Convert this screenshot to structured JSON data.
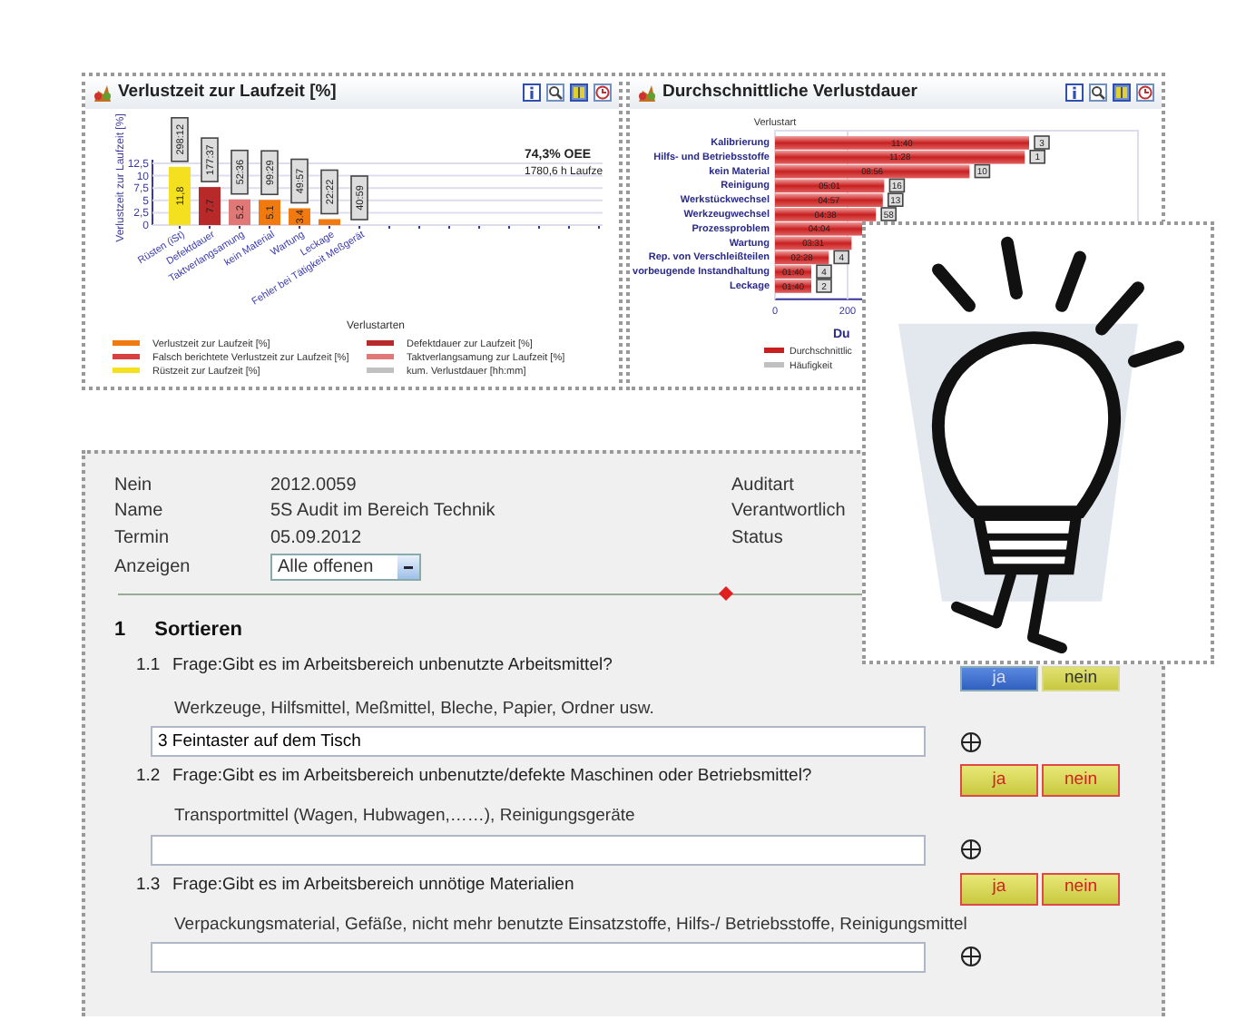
{
  "charts": [
    {
      "title": "Verlustzeit zur Laufzeit [%]",
      "summary": [
        "74,3% OEE",
        "1780,6 h Laufze"
      ],
      "chart_data": {
        "type": "bar",
        "xlabel": "Verlustarten",
        "ylabel": "Verlustzeit zur Laufzeit [%]",
        "categories": [
          "Rüsten (iSt)",
          "Defektdauer",
          "Taktverlangsamung",
          "kein Material",
          "Wartung",
          "Leckage",
          "Fehler bei Tätigkeit Meßgerät"
        ],
        "grid": true,
        "legend": true,
        "ylim": [
          0,
          12.5
        ],
        "yticks": [
          0,
          {
            "value": 2.5,
            "label": "2,5"
          },
          5,
          {
            "value": 7.5,
            "label": "7,5"
          },
          10,
          {
            "value": 12.5,
            "label": "12,5"
          }
        ],
        "series": [
          {
            "name": "Verlustzeit zur Laufzeit [%]",
            "color": "#f07a10",
            "values": [
              null,
              null,
              null,
              5.1,
              3.4,
              1.2,
              null
            ]
          },
          {
            "name": "Defektdauer zur Laufzeit [%]",
            "color": "#b82a2a",
            "values": [
              null,
              7.7,
              null,
              null,
              null,
              null,
              null
            ]
          },
          {
            "name": "Falsch berichtete Verlustzeit zur Laufzeit [%]",
            "color": "#d84040",
            "values": [
              null,
              null,
              null,
              null,
              null,
              null,
              null
            ]
          },
          {
            "name": "Taktverlangsamung zur Laufzeit [%]",
            "color": "#e07878",
            "values": [
              null,
              null,
              5.2,
              null,
              null,
              null,
              null
            ]
          },
          {
            "name": "Rüstzeit zur Laufzeit [%]",
            "color": "#f5e020",
            "values": [
              11.8,
              null,
              null,
              null,
              null,
              null,
              null
            ]
          },
          {
            "name": "kum. Verlustdauer [hh:mm]",
            "color": "#c0c0c0",
            "values": [
              null,
              null,
              null,
              null,
              null,
              null,
              null
            ]
          }
        ],
        "value_labels": [
          "11,8",
          "7.7",
          "5.2",
          "5.1",
          "3.4",
          null,
          null
        ],
        "annotations": [
          "298:12",
          "177:37",
          "52:36",
          "99:29",
          "49:57",
          "22:22",
          "40:59"
        ]
      }
    },
    {
      "title": "Durchschnittliche Verlustdauer",
      "chart_data": {
        "type": "bar",
        "orientation": "horizontal",
        "ylabel": "Verlustart",
        "xlabel": "Du",
        "categories": [
          "Kalibrierung",
          "Hilfs- und Betriebsstoffe",
          "kein Material",
          "Reinigung",
          "Werkstückwechsel",
          "Werkzeugwechsel",
          "Prozessproblem",
          "Wartung",
          "Rep. von Verschleißteilen",
          "vorbeugende Instandhaltung",
          "Leckage"
        ],
        "grid": true,
        "legend": true,
        "xlim": [
          0,
          1000
        ],
        "xticks": [
          0,
          200
        ],
        "series": [
          {
            "name": "Durchschnittlic",
            "color": "#c82020",
            "values": [
              700,
              688,
              536,
              301,
              297,
              278,
              244,
              211,
              148,
              100,
              100
            ]
          }
        ],
        "value_labels": [
          "11:40",
          "11:28",
          "08:56",
          "05:01",
          "04:57",
          "04:38",
          "04:04",
          "03:31",
          "02:28",
          "01:40",
          "01:40"
        ],
        "annotations": [
          "3",
          "1",
          "10",
          "16",
          "13",
          "58",
          null,
          null,
          "4",
          "4",
          "2"
        ]
      },
      "extra_legend": [
        {
          "name": "Häufigkeit",
          "color": "#c0c0c0"
        }
      ]
    }
  ],
  "audit": {
    "fields": [
      {
        "label": "Nein",
        "value": "2012.0059"
      },
      {
        "label": "Name",
        "value": "5S Audit im Bereich Technik"
      },
      {
        "label": "Termin",
        "value": "05.09.2012"
      }
    ],
    "right_labels": [
      "Auditart",
      "Verantwortlich",
      "Status"
    ],
    "filter": {
      "label": "Anzeigen",
      "value": "Alle offenen"
    }
  },
  "section": {
    "number": "1",
    "title": "Sortieren",
    "questions": [
      {
        "number": "1.1",
        "text": "Frage:Gibt es im Arbeitsbereich unbenutzte Arbeitsmittel?",
        "answered": true,
        "buttons": [
          {
            "label": "ja",
            "selected": true
          },
          {
            "label": "nein",
            "selected": false
          }
        ],
        "hint": "Werkzeuge, Hilfsmittel, Meßmittel, Bleche, Papier, Ordner usw.",
        "value": "3 Feintaster auf dem Tisch"
      },
      {
        "number": "1.2",
        "text": "Frage:Gibt es im Arbeitsbereich unbenutzte/defekte Maschinen oder Betriebsmittel?",
        "answered": false,
        "buttons": [
          {
            "label": "ja",
            "selected": false
          },
          {
            "label": "nein",
            "selected": false
          }
        ],
        "hint": "Transportmittel (Wagen, Hubwagen,……), Reinigungsgeräte"
      },
      {
        "number": "1.3",
        "text": "Frage:Gibt es im Arbeitsbereich unnötige Materialien",
        "answered": false,
        "buttons": [
          {
            "label": "ja",
            "selected": false
          },
          {
            "label": "nein",
            "selected": false
          }
        ],
        "hint": "Verpackungsmaterial, Gefäße, nicht mehr benutzte Einsatzstoffe, Hilfs-/ Betriebsstoffe, Reinigungsmittel"
      }
    ]
  }
}
